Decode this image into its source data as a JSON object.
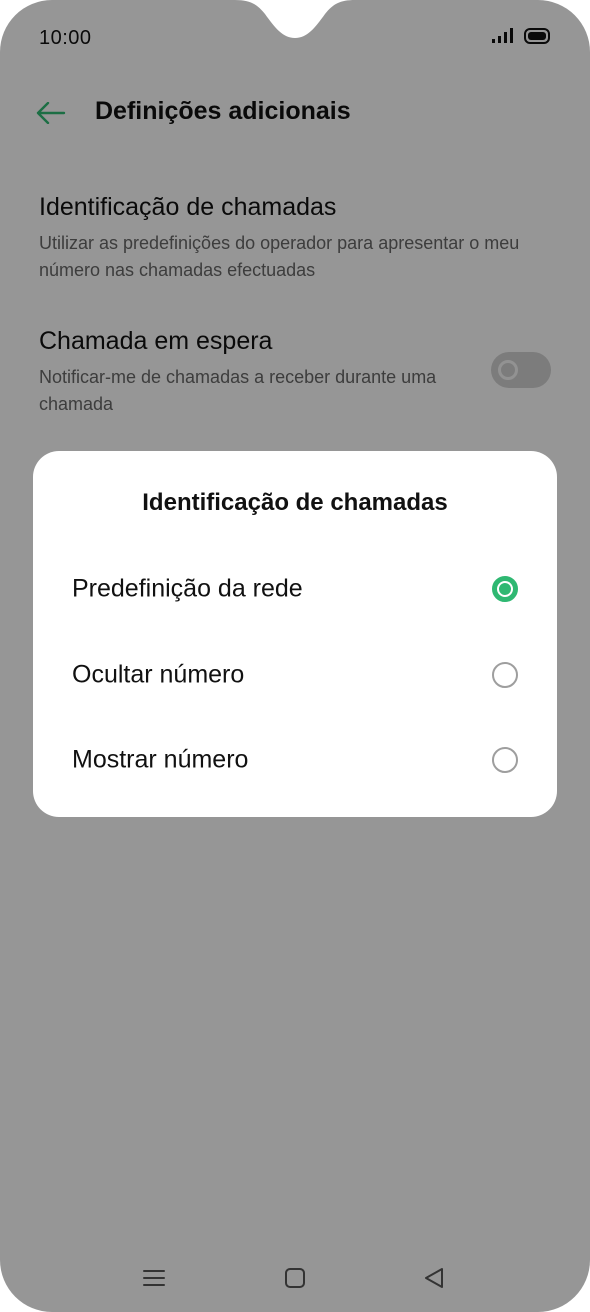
{
  "status_bar": {
    "time": "10:00",
    "icons": [
      "signal-icon",
      "battery-icon"
    ]
  },
  "header": {
    "title": "Definições adicionais",
    "back_icon": "arrow-left-icon"
  },
  "settings": [
    {
      "title": "Identificação de chamadas",
      "description": "Utilizar as predefinições do operador para apresentar o meu número nas chamadas efectuadas"
    },
    {
      "title": "Chamada em espera",
      "description": "Notificar-me de chamadas a receber durante uma chamada",
      "toggle_on": false
    }
  ],
  "dialog": {
    "title": "Identificação de chamadas",
    "options": [
      {
        "label": "Predefinição da rede",
        "selected": true
      },
      {
        "label": "Ocultar número",
        "selected": false
      },
      {
        "label": "Mostrar número",
        "selected": false
      }
    ]
  },
  "nav_bar": {
    "icons": [
      "menu-icon",
      "home-icon",
      "back-triangle-icon"
    ]
  },
  "colors": {
    "accent": "#2fb872",
    "scrim": "rgba(0,0,0,0.40)",
    "background": "#fafafa"
  }
}
